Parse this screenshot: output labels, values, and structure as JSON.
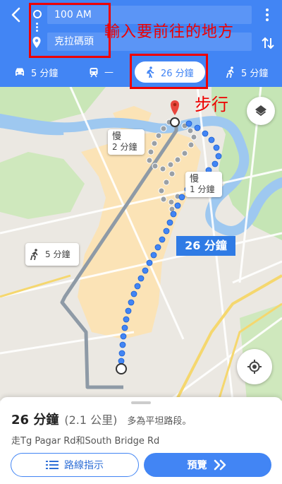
{
  "header": {
    "origin_value": "100 AM",
    "destination_value": "克拉碼頭"
  },
  "modes": {
    "drive": "5 分鐘",
    "transit": "—",
    "walk": "26 分鐘",
    "ride": "5 分鐘"
  },
  "annotations": {
    "input_hint": "輸入要前往的地方",
    "walk_hint": "步行"
  },
  "map": {
    "slow_label": "慢",
    "slow1_time": "2 分鐘",
    "slow2_time": "1 分鐘",
    "ride_time": "5 分鐘",
    "walk_badge": "26 分鐘"
  },
  "sheet": {
    "duration": "26 分鐘",
    "distance": "(2.1 公里)",
    "note": "多為平坦路段。",
    "via": "走Tg Pagar Rd和South Bridge Rd",
    "steps_button": "路線指示",
    "preview_button": "預覽"
  },
  "colors": {
    "header_blue": "#4285f4",
    "route_blue": "#4285f4",
    "annotation_red": "#e00000",
    "water": "#9ec8f0",
    "park": "#c5e5b5",
    "urban": "#fbe3b6"
  },
  "icons": [
    "back-arrow-icon",
    "origin-circle-icon",
    "destination-pin-icon",
    "more-vert-icon",
    "swap-icon",
    "car-icon",
    "train-icon",
    "walk-icon",
    "ride-icon",
    "layers-icon",
    "my-location-icon",
    "list-icon",
    "chevrons-right-icon"
  ]
}
